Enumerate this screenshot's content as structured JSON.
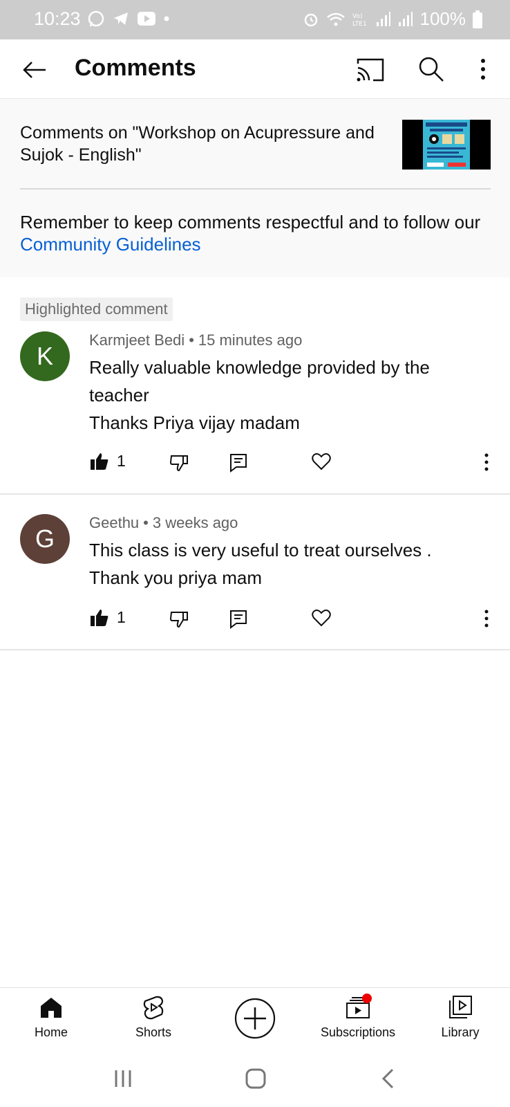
{
  "status_bar": {
    "time": "10:23",
    "battery": "100%",
    "icons": [
      "whatsapp-icon",
      "telegram-icon",
      "youtube-icon",
      "dot-icon",
      "alarm-icon",
      "wifi-icon",
      "volte-icon",
      "signal-icon",
      "signal-icon",
      "battery-icon"
    ]
  },
  "app_bar": {
    "title": "Comments",
    "icons": [
      "back-arrow-icon",
      "cast-icon",
      "search-icon",
      "more-vert-icon"
    ]
  },
  "video": {
    "title": "Comments on \"Workshop on Acupressure and Sujok - English\""
  },
  "guidelines": {
    "text": "Remember to keep comments respectful and to follow our ",
    "link": "Community Guidelines"
  },
  "comments": [
    {
      "badge": "Highlighted comment",
      "avatar_letter": "K",
      "avatar_color": "#33691e",
      "author": "Karmjeet Bedi",
      "time": "15 minutes ago",
      "line1": "Really valuable knowledge provided by the teacher",
      "line2": "Thanks Priya vijay madam",
      "likes": "1"
    },
    {
      "avatar_letter": "G",
      "avatar_color": "#5d4037",
      "author": "Geethu",
      "time": "3 weeks ago",
      "line1": "This class is very useful to treat ourselves .",
      "line2": "Thank you priya mam",
      "likes": "1"
    }
  ],
  "bottom_nav": {
    "home": "Home",
    "shorts": "Shorts",
    "subscriptions": "Subscriptions",
    "library": "Library"
  },
  "colors": {
    "link": "#065fd4",
    "status_bar": "#cccccc",
    "notification_dot": "#ee0000"
  }
}
